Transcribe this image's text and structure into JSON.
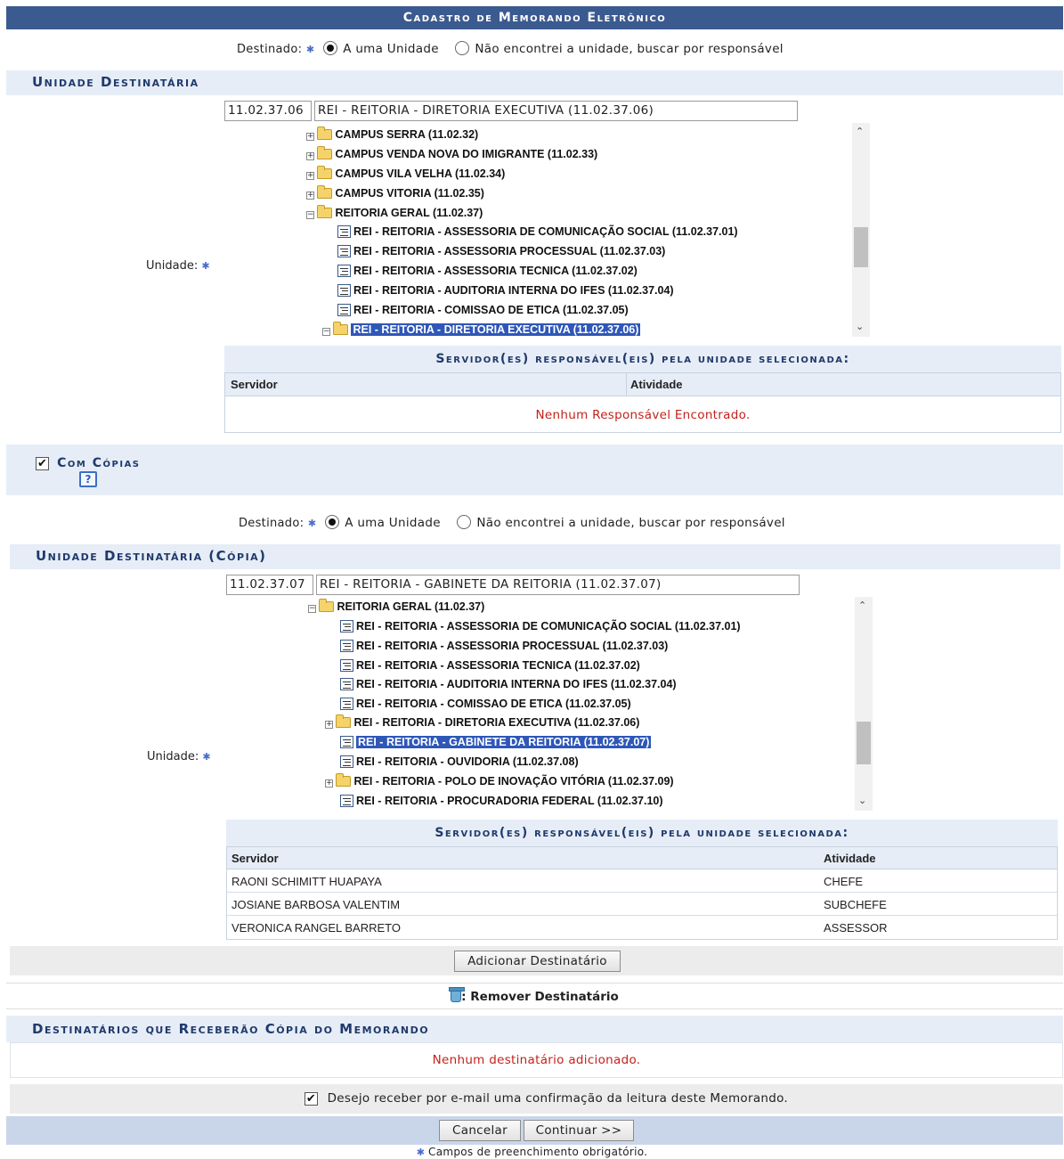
{
  "page": {
    "title": "Cadastro de Memorando Eletrônico"
  },
  "destino": {
    "label": "Destinado:",
    "option_unidade": "A uma Unidade",
    "option_responsavel": "Não encontrei a unidade, buscar por responsável"
  },
  "unidade_dest": {
    "heading": "Unidade Destinatária",
    "field_label": "Unidade:",
    "code": "11.02.37.06",
    "name": "REI - REITORIA - DIRETORIA EXECUTIVA (11.02.37.06)",
    "tree": [
      {
        "label": "CAMPUS SERRA (11.02.32)"
      },
      {
        "label": "CAMPUS VENDA NOVA DO IMIGRANTE (11.02.33)"
      },
      {
        "label": "CAMPUS VILA VELHA (11.02.34)"
      },
      {
        "label": "CAMPUS VITORIA (11.02.35)"
      },
      {
        "label": "REITORIA GERAL (11.02.37)"
      },
      {
        "label": "REI - REITORIA - ASSESSORIA DE COMUNICAÇÃO SOCIAL (11.02.37.01)"
      },
      {
        "label": "REI - REITORIA - ASSESSORIA PROCESSUAL (11.02.37.03)"
      },
      {
        "label": "REI - REITORIA - ASSESSORIA TECNICA (11.02.37.02)"
      },
      {
        "label": "REI - REITORIA - AUDITORIA INTERNA DO IFES (11.02.37.04)"
      },
      {
        "label": "REI - REITORIA - COMISSAO DE ETICA (11.02.37.05)"
      },
      {
        "label": "REI - REITORIA - DIRETORIA EXECUTIVA (11.02.37.06)"
      }
    ],
    "resp_heading": "Servidor(es) responsável(eis) pela unidade selecionada:",
    "col_servidor": "Servidor",
    "col_atividade": "Atividade",
    "empty": "Nenhum Responsável Encontrado."
  },
  "copias": {
    "label": "Com Cópias",
    "help": "?"
  },
  "unidade_copia": {
    "heading": "Unidade Destinatária (Cópia)",
    "field_label": "Unidade:",
    "code": "11.02.37.07",
    "name": "REI - REITORIA - GABINETE DA REITORIA (11.02.37.07)",
    "tree": [
      {
        "label": "REITORIA GERAL (11.02.37)"
      },
      {
        "label": "REI - REITORIA - ASSESSORIA DE COMUNICAÇÃO SOCIAL (11.02.37.01)"
      },
      {
        "label": "REI - REITORIA - ASSESSORIA PROCESSUAL (11.02.37.03)"
      },
      {
        "label": "REI - REITORIA - ASSESSORIA TECNICA (11.02.37.02)"
      },
      {
        "label": "REI - REITORIA - AUDITORIA INTERNA DO IFES (11.02.37.04)"
      },
      {
        "label": "REI - REITORIA - COMISSAO DE ETICA (11.02.37.05)"
      },
      {
        "label": "REI - REITORIA - DIRETORIA EXECUTIVA (11.02.37.06)"
      },
      {
        "label": "REI - REITORIA - GABINETE DA REITORIA (11.02.37.07)"
      },
      {
        "label": "REI - REITORIA - OUVIDORIA (11.02.37.08)"
      },
      {
        "label": "REI - REITORIA - POLO DE INOVAÇÃO VITÓRIA (11.02.37.09)"
      },
      {
        "label": "REI - REITORIA - PROCURADORIA FEDERAL (11.02.37.10)"
      }
    ],
    "resp_heading": "Servidor(es) responsável(eis) pela unidade selecionada:",
    "col_servidor": "Servidor",
    "col_atividade": "Atividade",
    "rows": [
      {
        "servidor": "RAONI SCHIMITT HUAPAYA",
        "atividade": "CHEFE"
      },
      {
        "servidor": "JOSIANE BARBOSA VALENTIM",
        "atividade": "SUBCHEFE"
      },
      {
        "servidor": "VERONICA RANGEL BARRETO",
        "atividade": "ASSESSOR"
      }
    ]
  },
  "actions": {
    "add_dest": "Adicionar Destinatário",
    "remove_legend": ": Remover Destinatário",
    "copia_heading": "Destinatários que Receberão Cópia do Memorando",
    "copia_empty": "Nenhum destinatário adicionado.",
    "email_confirm": "Desejo receber por e-mail uma confirmação da leitura deste Memorando.",
    "cancel": "Cancelar",
    "continue": "Continuar >>",
    "required_note": "Campos de preenchimento obrigatório."
  }
}
